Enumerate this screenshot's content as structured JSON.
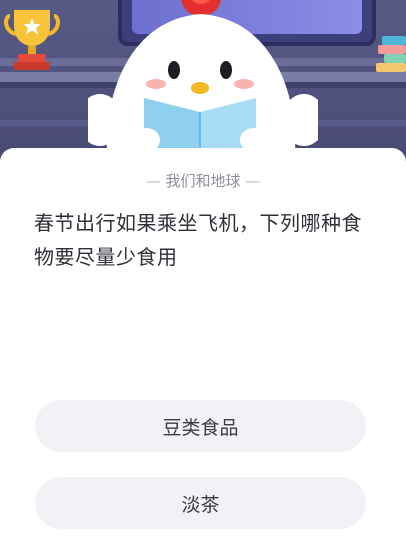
{
  "quiz": {
    "category": "我们和地球",
    "category_dash": "—",
    "question": "春节出行如果乘坐飞机，下列哪种食物要尽量少食用",
    "options": [
      {
        "label": "豆类食品"
      },
      {
        "label": "淡茶"
      }
    ]
  },
  "icons": {
    "trophy": "trophy-icon",
    "books": "book-stack-icon",
    "mascot": "chick-mascot-reading"
  },
  "colors": {
    "background_scene": "#585a86",
    "card": "#ffffff",
    "option_bg": "#f1f2f5",
    "trophy": "#f5b92a",
    "mascot_comb": "#e52e2e",
    "book": "#8fd0ef"
  }
}
